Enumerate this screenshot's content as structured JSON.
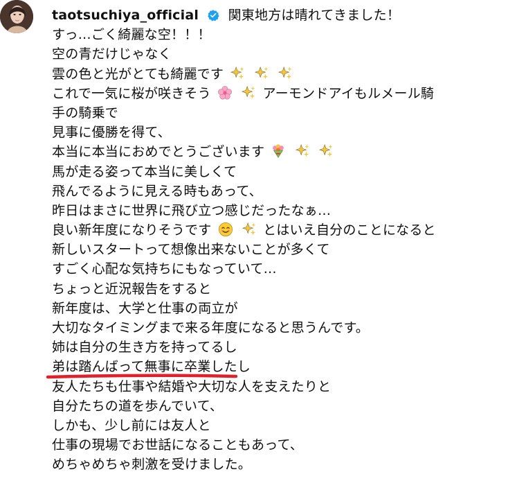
{
  "post": {
    "username": "taotsuchiya_official",
    "verified_icon": "verified-badge-icon",
    "lines": [
      "関東地方は晴れてきました！",
      "すっ…ごく綺麗な空！！！",
      "空の青だけじゃなく",
      "雲の色と光がとても綺麗です",
      "これで一気に桜が咲きそう",
      "アーモンドアイもルメール騎",
      "手の騎乗で",
      "見事に優勝を得て、",
      "本当に本当におめでとうございます",
      "馬が走る姿って本当に美しくて",
      "飛んでるように見える時もあって、",
      "昨日はまさに世界に飛び立つ感じだったなぁ…",
      "良い新年度になりそうです",
      "とはいえ自分のことになると",
      "新しいスタートって想像出来ないことが多くて",
      "すごく心配な気持ちにもなっていて…",
      "ちょっと近況報告をすると",
      "新年度は、大学と仕事の両立が",
      "大切なタイミングまで来る年度になると思うんです。",
      "姉は自分の生き方を持ってるし",
      "弟は踏んばって無事に卒業したし",
      "友人たちも仕事や結婚や大切な人を支えたりと",
      "自分たちの道を歩んでいて、",
      "しかも、少し前には友人と",
      "仕事の現場でお世話になることもあって、",
      "めちゃめちゃ刺激を受けました。"
    ],
    "emoji_icons": [
      "sparkles-icon",
      "cherry-blossom-icon",
      "bouquet-icon",
      "smiling-face-icon"
    ],
    "colors": {
      "verified": "#1da1f2",
      "underline": "#e0202a",
      "text": "#0f0f0f"
    }
  }
}
